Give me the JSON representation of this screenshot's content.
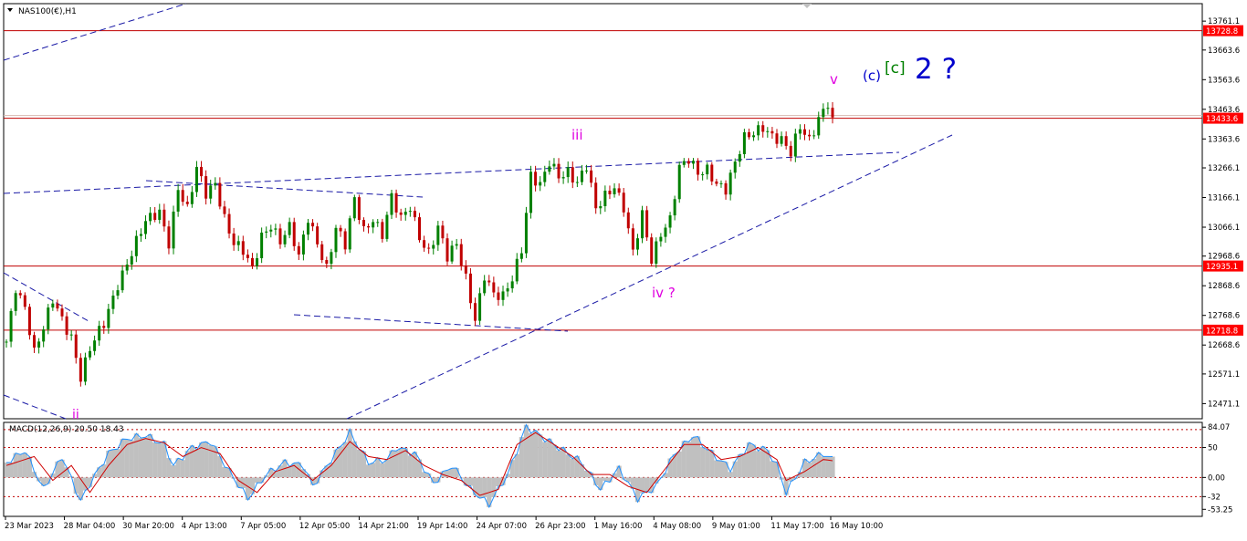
{
  "header": {
    "symbol_label": "NAS100(€),H1",
    "menu_icon": "triangle-down-icon"
  },
  "colors": {
    "background": "#ffffff",
    "frame": "#000000",
    "bull": "#008000",
    "bear": "#c00000",
    "trendline": "#1a1aa6",
    "level_line": "#c00000",
    "level_tag_bg": "#ff0000",
    "wave_magenta": "#e000e0",
    "wave_blue": "#0000cc",
    "wave_green": "#008000",
    "macd_hist": "#c0c0c0",
    "macd_main": "#1e90ff",
    "macd_signal": "#d00000"
  },
  "chart_data": [
    {
      "type": "candlestick",
      "symbol": "NAS100(€)",
      "timeframe": "H1",
      "ylim": [
        12420,
        13820
      ],
      "y_ticks": [
        {
          "value": 13761.1,
          "label": "13761.1"
        },
        {
          "value": 13663.6,
          "label": "13663.6"
        },
        {
          "value": 13563.6,
          "label": "13563.6"
        },
        {
          "value": 13463.6,
          "label": "13463.6"
        },
        {
          "value": 13363.6,
          "label": "13363.6"
        },
        {
          "value": 13266.1,
          "label": "13266.1"
        },
        {
          "value": 13166.1,
          "label": "13166.1"
        },
        {
          "value": 13066.1,
          "label": "13066.1"
        },
        {
          "value": 12968.6,
          "label": "12968.6"
        },
        {
          "value": 12868.6,
          "label": "12868.6"
        },
        {
          "value": 12768.6,
          "label": "12768.6"
        },
        {
          "value": 12668.6,
          "label": "12668.6"
        },
        {
          "value": 12571.1,
          "label": "12571.1"
        },
        {
          "value": 12471.1,
          "label": "12471.1"
        }
      ],
      "x_ticks": [
        "23 Mar 2023",
        "28 Mar 04:00",
        "30 Mar 20:00",
        "4 Apr 13:00",
        "7 Apr 05:00",
        "12 Apr 05:00",
        "14 Apr 21:00",
        "19 Apr 14:00",
        "24 Apr 07:00",
        "26 Apr 23:00",
        "1 May 16:00",
        "4 May 08:00",
        "9 May 01:00",
        "11 May 17:00",
        "16 May 10:00"
      ],
      "horizontal_levels": [
        {
          "value": 13728.8,
          "label": "13728.8"
        },
        {
          "value": 12935.1,
          "label": "12935.1"
        },
        {
          "value": 12718.8,
          "label": "12718.8"
        }
      ],
      "current_price": {
        "value": 13433.6,
        "label": "13433.6"
      },
      "price_path": [
        [
          0,
          12680
        ],
        [
          2,
          12870
        ],
        [
          4,
          12800
        ],
        [
          6,
          12640
        ],
        [
          8,
          12720
        ],
        [
          10,
          12820
        ],
        [
          12,
          12760
        ],
        [
          14,
          12700
        ],
        [
          16,
          12560
        ],
        [
          18,
          12650
        ],
        [
          21,
          12740
        ],
        [
          24,
          12880
        ],
        [
          27,
          12980
        ],
        [
          30,
          13080
        ],
        [
          33,
          13120
        ],
        [
          35,
          13020
        ],
        [
          37,
          13200
        ],
        [
          39,
          13120
        ],
        [
          41,
          13260
        ],
        [
          43,
          13180
        ],
        [
          45,
          13220
        ],
        [
          47,
          13100
        ],
        [
          49,
          13010
        ],
        [
          51,
          12980
        ],
        [
          53,
          12920
        ],
        [
          55,
          13040
        ],
        [
          57,
          13080
        ],
        [
          59,
          13020
        ],
        [
          61,
          13060
        ],
        [
          63,
          12960
        ],
        [
          65,
          13100
        ],
        [
          67,
          13020
        ],
        [
          69,
          12930
        ],
        [
          71,
          13060
        ],
        [
          73,
          13000
        ],
        [
          75,
          13160
        ],
        [
          77,
          13060
        ],
        [
          79,
          13100
        ],
        [
          81,
          13040
        ],
        [
          83,
          13160
        ],
        [
          85,
          13090
        ],
        [
          87,
          13140
        ],
        [
          89,
          13040
        ],
        [
          91,
          12980
        ],
        [
          93,
          13060
        ],
        [
          95,
          12960
        ],
        [
          97,
          13010
        ],
        [
          99,
          12900
        ],
        [
          101,
          12760
        ],
        [
          103,
          12900
        ],
        [
          105,
          12830
        ],
        [
          107,
          12830
        ],
        [
          109,
          12900
        ],
        [
          111,
          13000
        ],
        [
          113,
          13240
        ],
        [
          115,
          13200
        ],
        [
          117,
          13280
        ],
        [
          119,
          13240
        ],
        [
          121,
          13260
        ],
        [
          123,
          13220
        ],
        [
          125,
          13270
        ],
        [
          127,
          13120
        ],
        [
          129,
          13170
        ],
        [
          131,
          13210
        ],
        [
          133,
          13140
        ],
        [
          135,
          12980
        ],
        [
          137,
          13100
        ],
        [
          139,
          12950
        ],
        [
          141,
          13050
        ],
        [
          143,
          13100
        ],
        [
          145,
          13270
        ],
        [
          147,
          13290
        ],
        [
          149,
          13240
        ],
        [
          151,
          13260
        ],
        [
          153,
          13220
        ],
        [
          155,
          13200
        ],
        [
          157,
          13280
        ],
        [
          159,
          13360
        ],
        [
          161,
          13380
        ],
        [
          163,
          13410
        ],
        [
          165,
          13380
        ],
        [
          167,
          13360
        ],
        [
          169,
          13310
        ],
        [
          171,
          13400
        ],
        [
          173,
          13360
        ],
        [
          175,
          13440
        ],
        [
          177,
          13490
        ],
        [
          178,
          13420
        ]
      ]
    },
    {
      "type": "indicator",
      "label": "MACD(12,26,9) 20.50 18.43",
      "ylim": [
        -65,
        92
      ],
      "y_ticks": [
        {
          "value": 84.07,
          "label": "84.07"
        },
        {
          "value": 50,
          "label": "50"
        },
        {
          "value": 0,
          "label": "0.00"
        },
        {
          "value": -32,
          "label": "-32"
        },
        {
          "value": -53.25,
          "label": "-53.25"
        }
      ],
      "dotted_levels": [
        80,
        50,
        0,
        -32
      ],
      "macd_path": [
        [
          0,
          25
        ],
        [
          4,
          45
        ],
        [
          8,
          -20
        ],
        [
          12,
          35
        ],
        [
          16,
          -40
        ],
        [
          18,
          -10
        ],
        [
          22,
          40
        ],
        [
          26,
          65
        ],
        [
          30,
          70
        ],
        [
          34,
          55
        ],
        [
          36,
          20
        ],
        [
          40,
          50
        ],
        [
          44,
          60
        ],
        [
          48,
          10
        ],
        [
          52,
          -35
        ],
        [
          56,
          5
        ],
        [
          60,
          25
        ],
        [
          64,
          20
        ],
        [
          66,
          -15
        ],
        [
          70,
          30
        ],
        [
          74,
          75
        ],
        [
          78,
          25
        ],
        [
          82,
          30
        ],
        [
          84,
          50
        ],
        [
          88,
          40
        ],
        [
          92,
          -10
        ],
        [
          96,
          20
        ],
        [
          100,
          -20
        ],
        [
          104,
          -45
        ],
        [
          108,
          5
        ],
        [
          112,
          85
        ],
        [
          116,
          65
        ],
        [
          120,
          45
        ],
        [
          124,
          25
        ],
        [
          128,
          -20
        ],
        [
          132,
          15
        ],
        [
          136,
          -35
        ],
        [
          140,
          -15
        ],
        [
          144,
          40
        ],
        [
          148,
          70
        ],
        [
          152,
          40
        ],
        [
          156,
          15
        ],
        [
          160,
          55
        ],
        [
          164,
          45
        ],
        [
          166,
          20
        ],
        [
          168,
          -25
        ],
        [
          172,
          25
        ],
        [
          176,
          40
        ],
        [
          178,
          30
        ]
      ],
      "signal_path": [
        [
          0,
          20
        ],
        [
          6,
          35
        ],
        [
          10,
          -5
        ],
        [
          14,
          20
        ],
        [
          18,
          -25
        ],
        [
          22,
          20
        ],
        [
          26,
          55
        ],
        [
          30,
          65
        ],
        [
          34,
          58
        ],
        [
          38,
          35
        ],
        [
          42,
          50
        ],
        [
          46,
          40
        ],
        [
          50,
          -5
        ],
        [
          54,
          -25
        ],
        [
          58,
          10
        ],
        [
          62,
          20
        ],
        [
          66,
          -5
        ],
        [
          70,
          20
        ],
        [
          74,
          60
        ],
        [
          78,
          35
        ],
        [
          82,
          30
        ],
        [
          86,
          45
        ],
        [
          90,
          20
        ],
        [
          94,
          5
        ],
        [
          98,
          -5
        ],
        [
          102,
          -30
        ],
        [
          106,
          -20
        ],
        [
          110,
          55
        ],
        [
          114,
          75
        ],
        [
          118,
          55
        ],
        [
          122,
          35
        ],
        [
          126,
          5
        ],
        [
          130,
          5
        ],
        [
          134,
          -15
        ],
        [
          138,
          -25
        ],
        [
          142,
          15
        ],
        [
          146,
          55
        ],
        [
          150,
          55
        ],
        [
          154,
          30
        ],
        [
          158,
          35
        ],
        [
          162,
          50
        ],
        [
          166,
          30
        ],
        [
          168,
          -5
        ],
        [
          172,
          10
        ],
        [
          176,
          30
        ],
        [
          178,
          28
        ]
      ]
    }
  ],
  "annotations": {
    "wave_ii": "ii",
    "wave_iii": "iii",
    "wave_iv": "iv ?",
    "wave_v": "v",
    "wave_c_paren": "(c)",
    "wave_c_bracket": "[c]",
    "wave_2": "2 ?"
  }
}
